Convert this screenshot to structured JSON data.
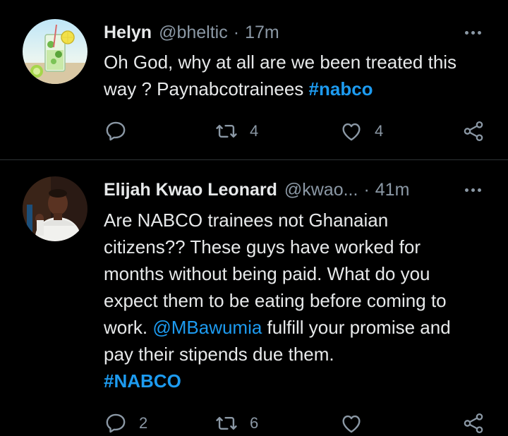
{
  "tweets": [
    {
      "name": "Helyn",
      "handle": "@bheltic",
      "separator": "·",
      "time": "17m",
      "text_line1": "Oh God, why at all are we been treated this",
      "text_line2_prefix": "way ? Paynabcotrainees ",
      "hashtag": "#nabco",
      "retweets": "4",
      "likes": "4",
      "avatar": "lemon-mojito-drink",
      "icons": [
        "reply-icon",
        "retweet-icon",
        "like-icon",
        "share-icon",
        "more-icon"
      ]
    },
    {
      "name": "Elijah Kwao Leonard",
      "handle": "@kwao...",
      "separator": "·",
      "time": "41m",
      "lines": [
        "Are NABCO trainees not Ghanaian",
        "citizens?? These guys have worked for",
        "months without being paid. What do you",
        "expect them to be eating before coming to"
      ],
      "line5_prefix": "work. ",
      "mention": "@MBawumia",
      "line5_suffix": " fulfill your promise and",
      "line6": "pay their stipends due them.",
      "hashtag": "#NABCO",
      "replies": "2",
      "retweets": "6",
      "avatar": "man-in-white-shirt"
    }
  ],
  "colors": {
    "background": "#000000",
    "text": "#e7e9ea",
    "secondary": "#8b98a5",
    "link": "#1d9bf0",
    "divider": "#2f3336"
  }
}
